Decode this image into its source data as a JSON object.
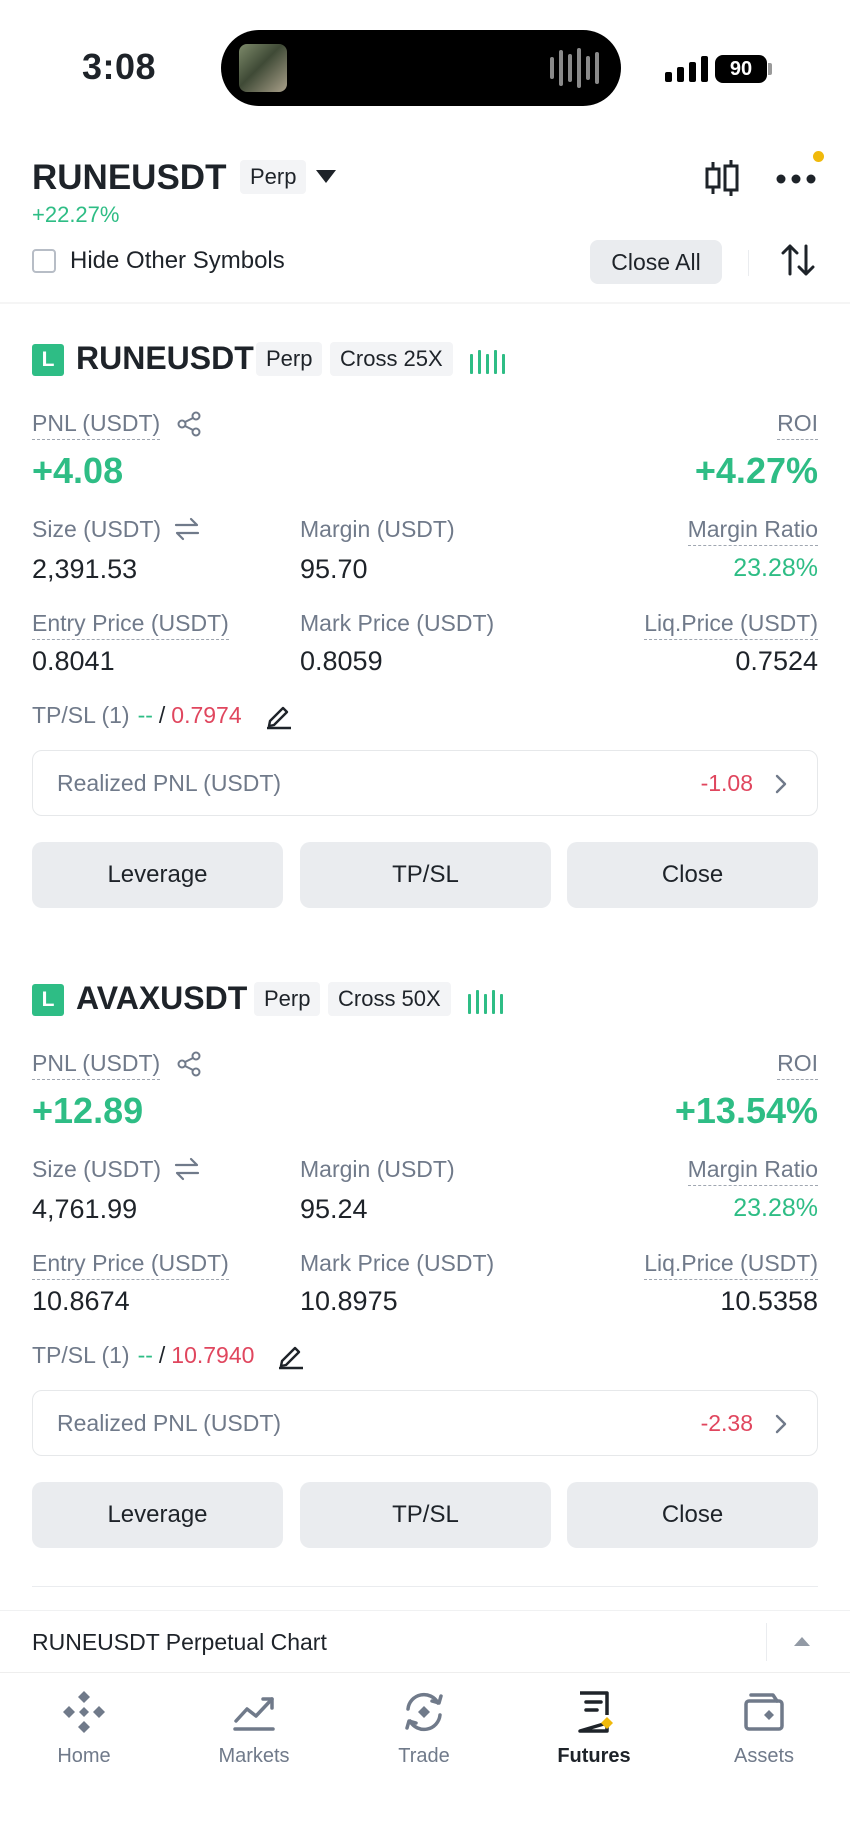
{
  "status_bar": {
    "time": "3:08",
    "battery": "90"
  },
  "header": {
    "symbol": "RUNEUSDT",
    "type_tag": "Perp",
    "change": "+22.27%",
    "hide_other_symbols_label": "Hide Other Symbols",
    "hide_other_symbols_checked": false,
    "close_all_label": "Close All",
    "icons": [
      "chevron-down-icon",
      "candlestick-chart-icon",
      "more-icon",
      "sort-icon"
    ],
    "notification_dot_color": "#f0b90b"
  },
  "positions": [
    {
      "side_badge": "L",
      "symbol": "RUNEUSDT",
      "type_tag": "Perp",
      "margin_tag": "Cross 25X",
      "pnl_label": "PNL (USDT)",
      "pnl_value": "+4.08",
      "roi_label": "ROI",
      "roi_value": "+4.27%",
      "size_label": "Size (USDT)",
      "size_value": "2,391.53",
      "margin_label": "Margin (USDT)",
      "margin_value": "95.70",
      "margin_ratio_label": "Margin Ratio",
      "margin_ratio_value": "23.28%",
      "entry_label": "Entry Price (USDT)",
      "entry_value": "0.8041",
      "mark_label": "Mark Price (USDT)",
      "mark_value": "0.8059",
      "liq_label": "Liq.Price (USDT)",
      "liq_value": "0.7524",
      "tpsl_label": "TP/SL (1)",
      "tp_value": "--",
      "tpsl_sep": "/",
      "sl_value": "0.7974",
      "realized_label": "Realized PNL (USDT)",
      "realized_value": "-1.08",
      "buttons": {
        "leverage": "Leverage",
        "tpsl": "TP/SL",
        "close": "Close"
      }
    },
    {
      "side_badge": "L",
      "symbol": "AVAXUSDT",
      "type_tag": "Perp",
      "margin_tag": "Cross 50X",
      "pnl_label": "PNL (USDT)",
      "pnl_value": "+12.89",
      "roi_label": "ROI",
      "roi_value": "+13.54%",
      "size_label": "Size (USDT)",
      "size_value": "4,761.99",
      "margin_label": "Margin (USDT)",
      "margin_value": "95.24",
      "margin_ratio_label": "Margin Ratio",
      "margin_ratio_value": "23.28%",
      "entry_label": "Entry Price (USDT)",
      "entry_value": "10.8674",
      "mark_label": "Mark Price (USDT)",
      "mark_value": "10.8975",
      "liq_label": "Liq.Price (USDT)",
      "liq_value": "10.5358",
      "tpsl_label": "TP/SL (1)",
      "tp_value": "--",
      "tpsl_sep": "/",
      "sl_value": "10.7940",
      "realized_label": "Realized PNL (USDT)",
      "realized_value": "-2.38",
      "buttons": {
        "leverage": "Leverage",
        "tpsl": "TP/SL",
        "close": "Close"
      }
    }
  ],
  "chart_section": {
    "title": "RUNEUSDT Perpetual Chart"
  },
  "bottom_nav": {
    "items": [
      {
        "label": "Home",
        "icon": "home-icon"
      },
      {
        "label": "Markets",
        "icon": "markets-icon"
      },
      {
        "label": "Trade",
        "icon": "trade-icon"
      },
      {
        "label": "Futures",
        "icon": "futures-icon",
        "active": true
      },
      {
        "label": "Assets",
        "icon": "assets-icon"
      }
    ]
  },
  "colors": {
    "profit": "#2ebd85",
    "loss": "#e0465e",
    "accent": "#f0b90b",
    "text": "#1e2329",
    "muted": "#707a8a"
  }
}
